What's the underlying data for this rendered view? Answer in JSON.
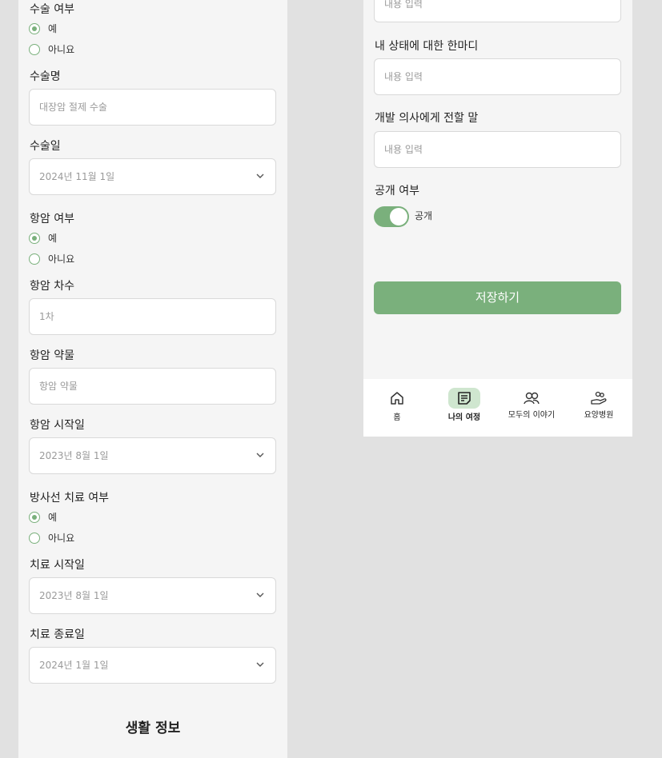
{
  "left": {
    "surgery_label": "수술 여부",
    "surgery_yes": "예",
    "surgery_no": "아니요",
    "surgery_name_label": "수술명",
    "surgery_name_value": "대장암 절제 수술",
    "surgery_date_label": "수술일",
    "surgery_date_value": "2024년 11월 1일",
    "chemo_label": "항암 여부",
    "chemo_yes": "예",
    "chemo_no": "아니요",
    "chemo_round_label": "항암 차수",
    "chemo_round_value": "1차",
    "chemo_drug_label": "항암 약물",
    "chemo_drug_value": "항암 약물",
    "chemo_start_label": "항암 시작일",
    "chemo_start_value": "2023년 8월 1일",
    "radiation_label": "방사선 치료 여부",
    "radiation_yes": "예",
    "radiation_no": "아니요",
    "treat_start_label": "치료 시작일",
    "treat_start_value": "2023년 8월 1일",
    "treat_end_label": "치료 종료일",
    "treat_end_value": "2024년 1월 1일",
    "life_section_title": "생활 정보"
  },
  "right": {
    "top_input_value": "내용 입력",
    "status_label": "내 상태에 대한 한마디",
    "status_value": "내용 입력",
    "doctor_label": "개발 의사에게 전할 말",
    "doctor_value": "내용 입력",
    "public_label": "공개 여부",
    "public_toggle_text": "공개",
    "public_on": true,
    "save_label": "저장하기"
  },
  "nav": {
    "items": [
      {
        "label": "홈",
        "icon": "home-icon",
        "active": false
      },
      {
        "label": "나의 여정",
        "icon": "note-icon",
        "active": true
      },
      {
        "label": "모두의 이야기",
        "icon": "people-icon",
        "active": false
      },
      {
        "label": "요양병원",
        "icon": "care-hand-icon",
        "active": false
      }
    ]
  },
  "colors": {
    "accent": "#7ab07c",
    "accent_light": "#cfe6cf",
    "background": "#e1e1e1",
    "panel": "#f5f5f5"
  }
}
